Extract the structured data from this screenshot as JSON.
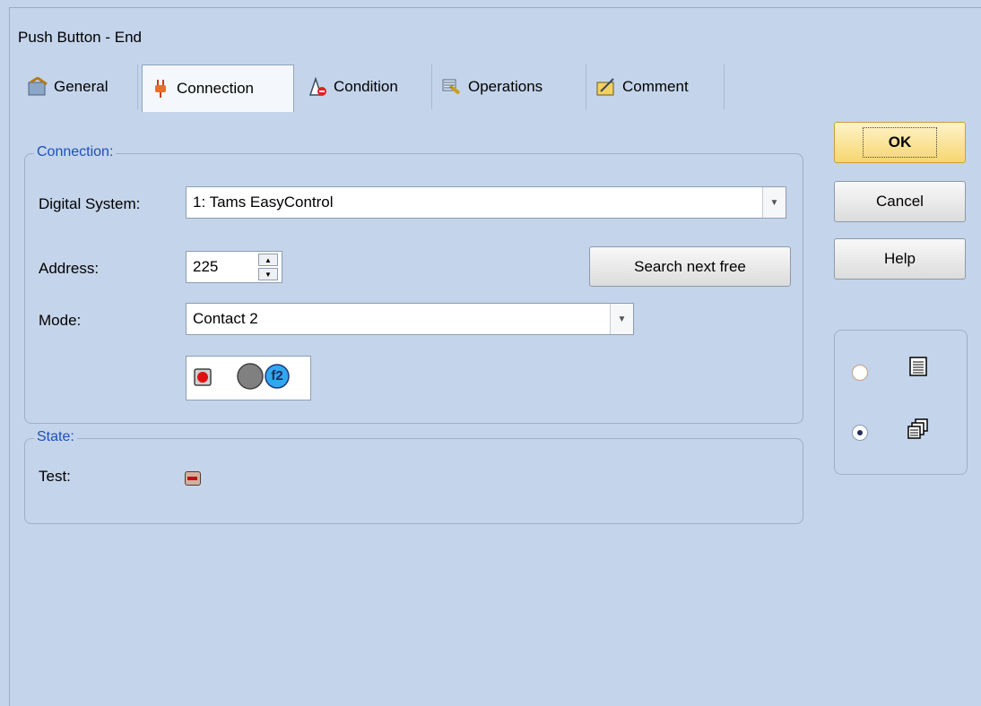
{
  "dialog": {
    "title": "Push Button - End"
  },
  "tabs": [
    {
      "label": "General",
      "icon": "general-icon"
    },
    {
      "label": "Connection",
      "icon": "plug-icon"
    },
    {
      "label": "Condition",
      "icon": "condition-icon"
    },
    {
      "label": "Operations",
      "icon": "operations-icon"
    },
    {
      "label": "Comment",
      "icon": "comment-icon"
    }
  ],
  "connection": {
    "legend": "Connection:",
    "digital_system_label": "Digital System:",
    "digital_system_value": "1: Tams EasyControl",
    "address_label": "Address:",
    "address_value": "225",
    "search_button": "Search next free",
    "mode_label": "Mode:",
    "mode_value": "Contact 2",
    "contact_badge": "f2"
  },
  "state": {
    "legend": "State:",
    "test_label": "Test:"
  },
  "buttons": {
    "ok": "OK",
    "cancel": "Cancel",
    "help": "Help"
  },
  "view_options": {
    "selected": "second",
    "options": [
      "list-view-icon",
      "multi-window-icon"
    ]
  },
  "colors": {
    "legend": "#1d4fb8",
    "ok_bg": "#f6d670",
    "indicator_red": "#e01010",
    "badge_blue": "#30a8f0"
  }
}
